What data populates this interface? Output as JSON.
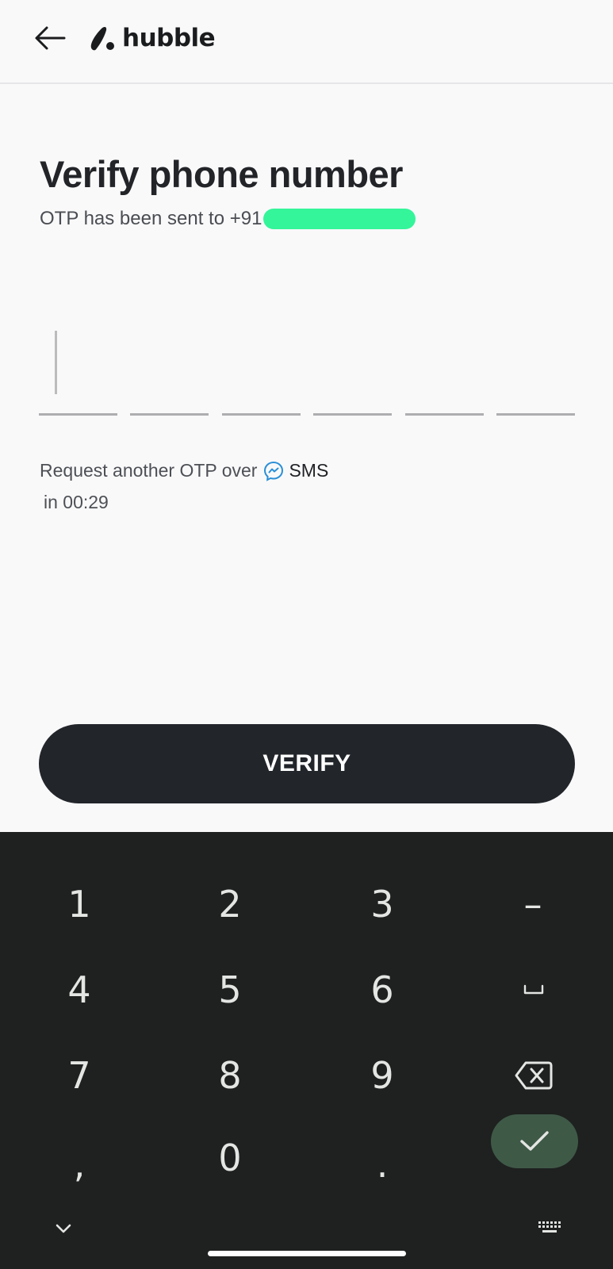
{
  "header": {
    "back_icon": "arrow-left-icon",
    "logo_text": "hubble"
  },
  "main": {
    "title": "Verify phone number",
    "subtitle_prefix": "OTP has been sent to +91",
    "otp_slots": 6,
    "resend_text": "Request another OTP over",
    "resend_channel": "SMS",
    "resend_icon": "chat-bubble-icon",
    "timer_text": "in 00:29",
    "verify_label": "VERIFY"
  },
  "keyboard": {
    "keys": [
      "1",
      "2",
      "3",
      "4",
      "5",
      "6",
      "7",
      "8",
      "9",
      ",",
      "0",
      "."
    ],
    "dash_key": "–",
    "space_icon": "space-bar-icon",
    "backspace_icon": "backspace-icon",
    "ok_icon": "checkmark-icon",
    "collapse_icon": "chevron-down-icon",
    "switch_keyboard_icon": "keyboard-icon"
  },
  "colors": {
    "masked_phone": "#34f59a",
    "button_dark": "#22252a",
    "keyboard_bg": "#1e2120",
    "ok_key": "#3f5947"
  }
}
